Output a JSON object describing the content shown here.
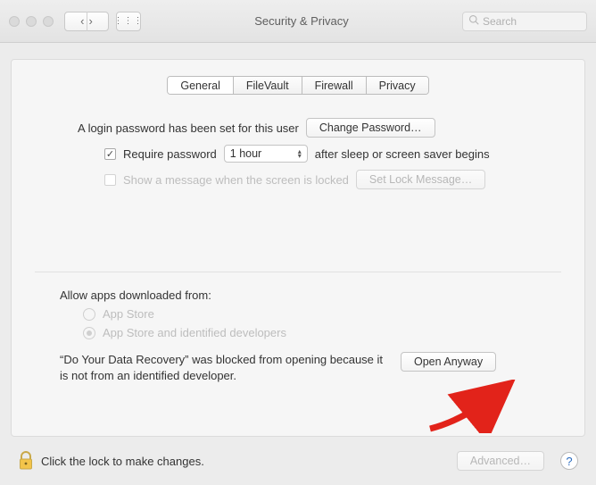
{
  "window": {
    "title": "Security & Privacy"
  },
  "search": {
    "placeholder": "Search"
  },
  "tabs": [
    {
      "label": "General"
    },
    {
      "label": "FileVault"
    },
    {
      "label": "Firewall"
    },
    {
      "label": "Privacy"
    }
  ],
  "general": {
    "login_pw_set": "A login password has been set for this user",
    "change_password": "Change Password…",
    "require_password_pre": "Require password",
    "require_password_value": "1 hour",
    "require_password_post": "after sleep or screen saver begins",
    "show_message": "Show a message when the screen is locked",
    "set_lock_message": "Set Lock Message…"
  },
  "gatekeeper": {
    "heading": "Allow apps downloaded from:",
    "option_appstore": "App Store",
    "option_identified": "App Store and identified developers",
    "blocked_text": "“Do Your Data Recovery” was blocked from opening because it is not from an identified developer.",
    "open_anyway": "Open Anyway"
  },
  "footer": {
    "lock_text": "Click the lock to make changes.",
    "advanced": "Advanced…",
    "help": "?"
  }
}
